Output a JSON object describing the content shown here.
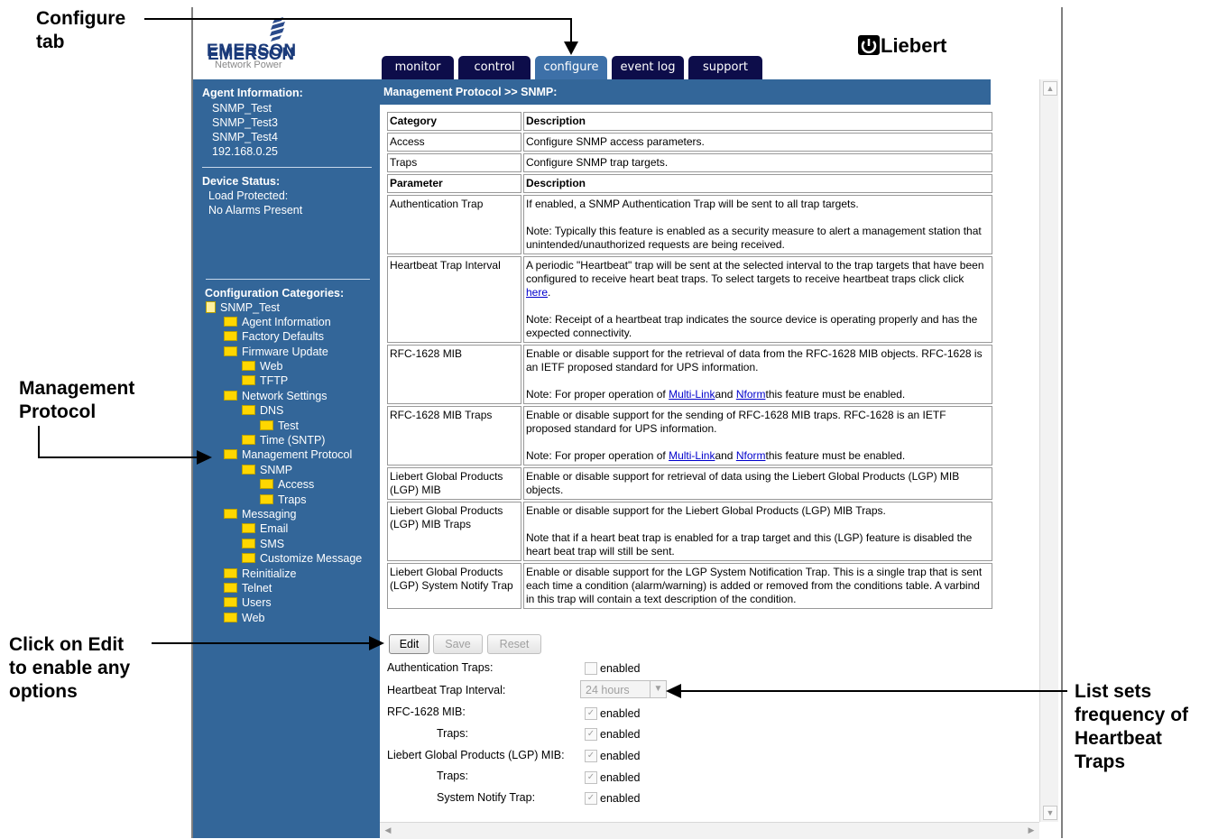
{
  "annotations": {
    "configure_tab": [
      "Configure",
      "tab"
    ],
    "management_protocol": [
      "Management",
      "Protocol"
    ],
    "click_edit": [
      "Click on Edit",
      "to enable any",
      "options"
    ],
    "list_sets": [
      "List sets",
      "frequency of",
      "Heartbeat",
      "Traps"
    ]
  },
  "logos": {
    "emerson": "EMERSON",
    "emerson_sub": "Network Power",
    "liebert": "Liebert"
  },
  "tabs": [
    {
      "label": "monitor"
    },
    {
      "label": "control"
    },
    {
      "label": "configure"
    },
    {
      "label": "event log"
    },
    {
      "label": "support"
    }
  ],
  "sidebar": {
    "agent_info_title": "Agent Information:",
    "agent_lines": [
      "SNMP_Test",
      "SNMP_Test3",
      "SNMP_Test4",
      "192.168.0.25"
    ],
    "device_status_title": "Device Status:",
    "device_lines": [
      "Load Protected:",
      "No Alarms Present"
    ],
    "config_title": "Configuration Categories:",
    "tree": [
      "SNMP_Test",
      "Agent Information",
      "Factory Defaults",
      "Firmware Update",
      "Web",
      "TFTP",
      "Network Settings",
      "DNS",
      "Test",
      "Time (SNTP)",
      "Management Protocol",
      "SNMP",
      "Access",
      "Traps",
      "Messaging",
      "Email",
      "SMS",
      "Customize Message",
      "Reinitialize",
      "Telnet",
      "Users",
      "Web"
    ]
  },
  "breadcrumb": "Management Protocol >> SNMP:",
  "table": {
    "h1": [
      "Category",
      "Description"
    ],
    "rows1": [
      [
        "Access",
        "Configure SNMP access parameters."
      ],
      [
        "Traps",
        "Configure SNMP trap targets."
      ]
    ],
    "h2": [
      "Parameter",
      "Description"
    ],
    "auth": {
      "name": "Authentication Trap",
      "d1": "If enabled, a SNMP Authentication Trap will be sent to all trap targets.",
      "d2": "Note: Typically this feature is enabled as a security measure to alert a management station that unintended/unauthorized requests are being received."
    },
    "hb": {
      "name": "Heartbeat Trap Interval",
      "d1": "A periodic \"Heartbeat\" trap will be sent at the selected interval to the trap targets that have been configured to receive heart beat traps. To select targets to receive heartbeat traps click click ",
      "link": "here",
      "d1end": ".",
      "d2": "Note: Receipt of a heartbeat trap indicates the source device is operating properly and has the expected connectivity."
    },
    "rfc": {
      "name": "RFC-1628 MIB",
      "d1": "Enable or disable support for the retrieval of data from the RFC-1628 MIB objects. RFC-1628 is an IETF proposed standard for UPS information.",
      "note": "Note: For proper operation of ",
      "link1": "Multi-Link",
      "and": "and ",
      "link2": "Nform",
      "end": "this feature must be enabled."
    },
    "rfct": {
      "name": "RFC-1628 MIB Traps",
      "d1": "Enable or disable support for the sending of RFC-1628 MIB traps. RFC-1628 is an IETF proposed standard for UPS information.",
      "note": "Note: For proper operation of ",
      "link1": "Multi-Link",
      "and": "and ",
      "link2": "Nform",
      "end": "this feature must be enabled."
    },
    "lgp": {
      "name": "Liebert Global Products (LGP) MIB",
      "d1": "Enable or disable support for retrieval of data using the Liebert Global Products (LGP) MIB objects."
    },
    "lgpt": {
      "name": "Liebert Global Products (LGP) MIB Traps",
      "d1": "Enable or disable support for the Liebert Global Products (LGP) MIB Traps.",
      "d2": "Note that if a heart beat trap is enabled for a trap target and this (LGP) feature is disabled the heart beat trap will still be sent."
    },
    "lgpn": {
      "name": "Liebert Global Products (LGP) System Notify Trap",
      "d1": "Enable or disable support for the LGP System Notification Trap. This is a single trap that is sent each time a condition (alarm/warning) is added or removed from the conditions table. A varbind in this trap will contain a text description of the condition."
    }
  },
  "buttons": {
    "edit": "Edit",
    "save": "Save",
    "reset": "Reset"
  },
  "form": {
    "auth_label": "Authentication Traps:",
    "hb_label": "Heartbeat Trap Interval:",
    "hb_value": "24 hours",
    "rfc_label": "RFC-1628 MIB:",
    "rfc_traps_label": "Traps:",
    "lgp_label": "Liebert Global Products (LGP) MIB:",
    "lgp_traps_label": "Traps:",
    "lgp_notify_label": "System Notify Trap:",
    "enabled": "enabled"
  }
}
